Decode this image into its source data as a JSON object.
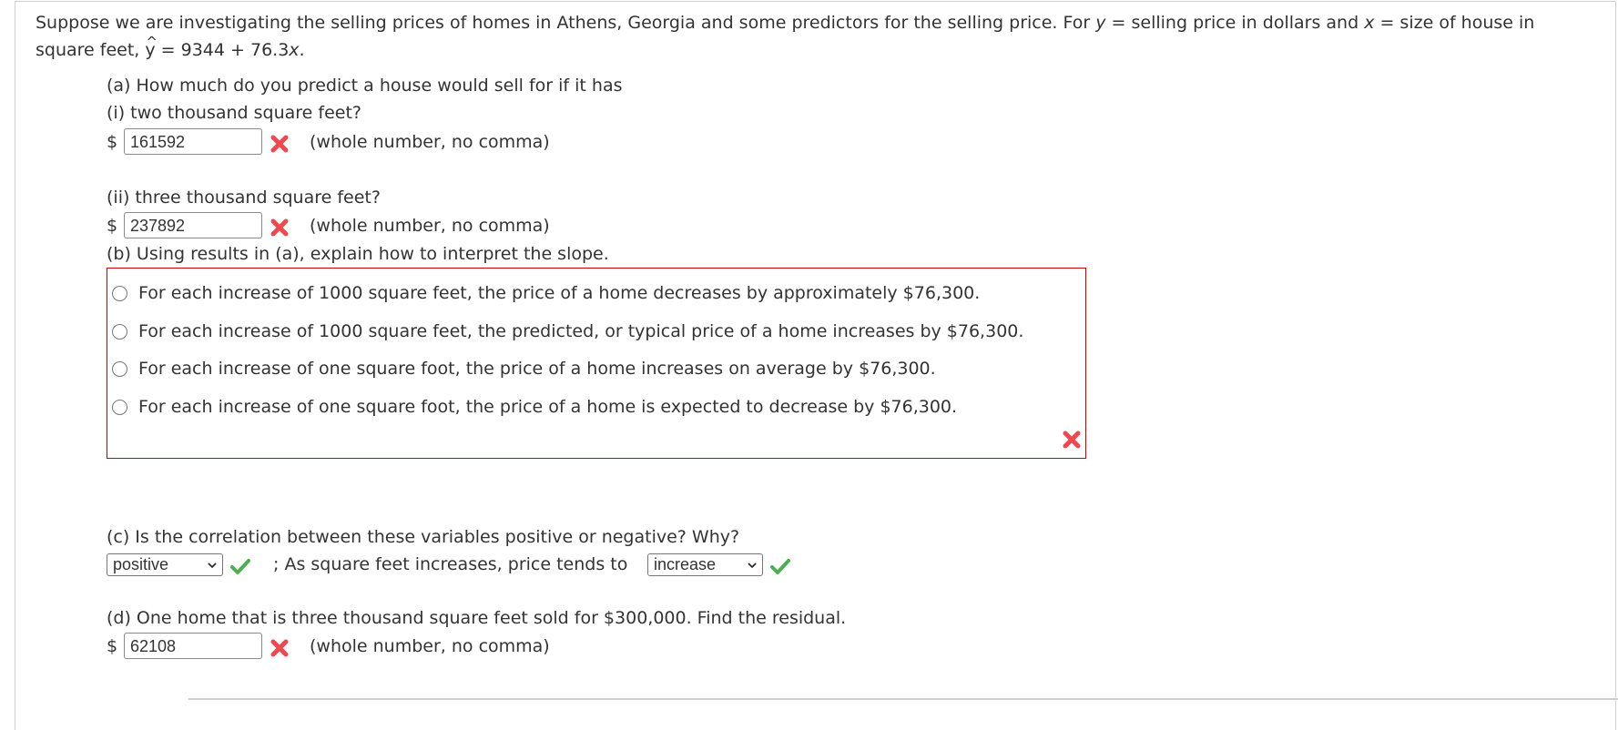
{
  "intro": {
    "line1_a": "Suppose we are investigating the selling prices of homes in Athens, Georgia and some predictors for the selling price. For ",
    "var_y": "y",
    "line1_b": " = selling price in dollars and ",
    "var_x": "x",
    "line1_c": " = size of house in",
    "line2_a": "square feet, ",
    "yhat_letter": "y",
    "yhat_hat": "^",
    "line2_b": " = 9344 + 76.3",
    "line2_var": "x",
    "line2_end": "."
  },
  "part_a": {
    "question": "(a) How much do you predict a house would sell for if it has",
    "sub_i": {
      "label": "(i) two thousand square feet?",
      "currency": "$",
      "value": "161592",
      "status": "incorrect",
      "hint": "(whole number, no comma)"
    },
    "sub_ii": {
      "label": "(ii) three thousand square feet?",
      "currency": "$",
      "value": "237892",
      "status": "incorrect",
      "hint": "(whole number, no comma)"
    }
  },
  "part_b": {
    "question": "(b) Using results in (a), explain how to interpret the slope.",
    "status": "incorrect",
    "options": [
      {
        "label": "For each increase of 1000 square feet, the price of a home decreases by approximately $76,300.",
        "selected": false
      },
      {
        "label": "For each increase of 1000 square feet, the predicted, or typical price of a home increases by $76,300.",
        "selected": false
      },
      {
        "label": "For each increase of one square foot, the price of a home increases on average by $76,300.",
        "selected": false
      },
      {
        "label": "For each increase of one square foot, the price of a home is expected to decrease by $76,300.",
        "selected": false
      }
    ]
  },
  "part_c": {
    "question": "(c) Is the correlation between these variables positive or negative? Why?",
    "select1_value": "positive",
    "select1_status": "correct",
    "middle_text": "; As square feet increases, price tends to",
    "select2_value": "increase",
    "select2_status": "correct"
  },
  "part_d": {
    "question": "(d) One home that is three thousand square feet sold for $300,000. Find the residual.",
    "currency": "$",
    "value": "62108",
    "status": "incorrect",
    "hint": "(whole number, no comma)"
  },
  "colors": {
    "error_border": "#cc0000",
    "incorrect_icon": "#f0484f",
    "correct_icon": "#4caf50",
    "text": "#333333"
  }
}
